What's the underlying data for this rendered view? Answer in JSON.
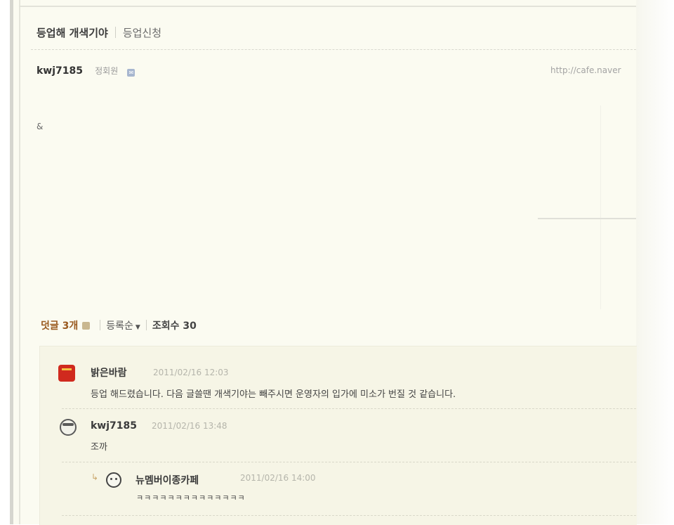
{
  "post": {
    "title": "등업해 개색기야",
    "category": "등업신청",
    "author": "kwj7185",
    "author_grade": "정회원",
    "url": "http://cafe.naver",
    "body": "&"
  },
  "comments_header": {
    "count_label": "덧글 3개",
    "sort_label": "등록순",
    "views_label": "조회수 30"
  },
  "comments": [
    {
      "author": "밝은바람",
      "date": "2011/02/16 12:03",
      "text": "등업 해드렸습니다. 다음 글쓸땐 개색기야는 빼주시면 운영자의 입가에 미소가 번질 것 같습니다."
    },
    {
      "author": "kwj7185",
      "date": "2011/02/16 13:48",
      "text": "조까"
    },
    {
      "author": "뉴멤버이종카페",
      "date": "2011/02/16 14:00",
      "text": "ㅋㅋㅋㅋㅋㅋㅋㅋㅋㅋㅋㅋㅋㅋ",
      "is_reply": true
    }
  ],
  "icons": {
    "author_badge": "note-icon",
    "comment_badge": "comment-icon",
    "sort": "chevron-down-icon",
    "reply": "reply-arrow-icon"
  }
}
